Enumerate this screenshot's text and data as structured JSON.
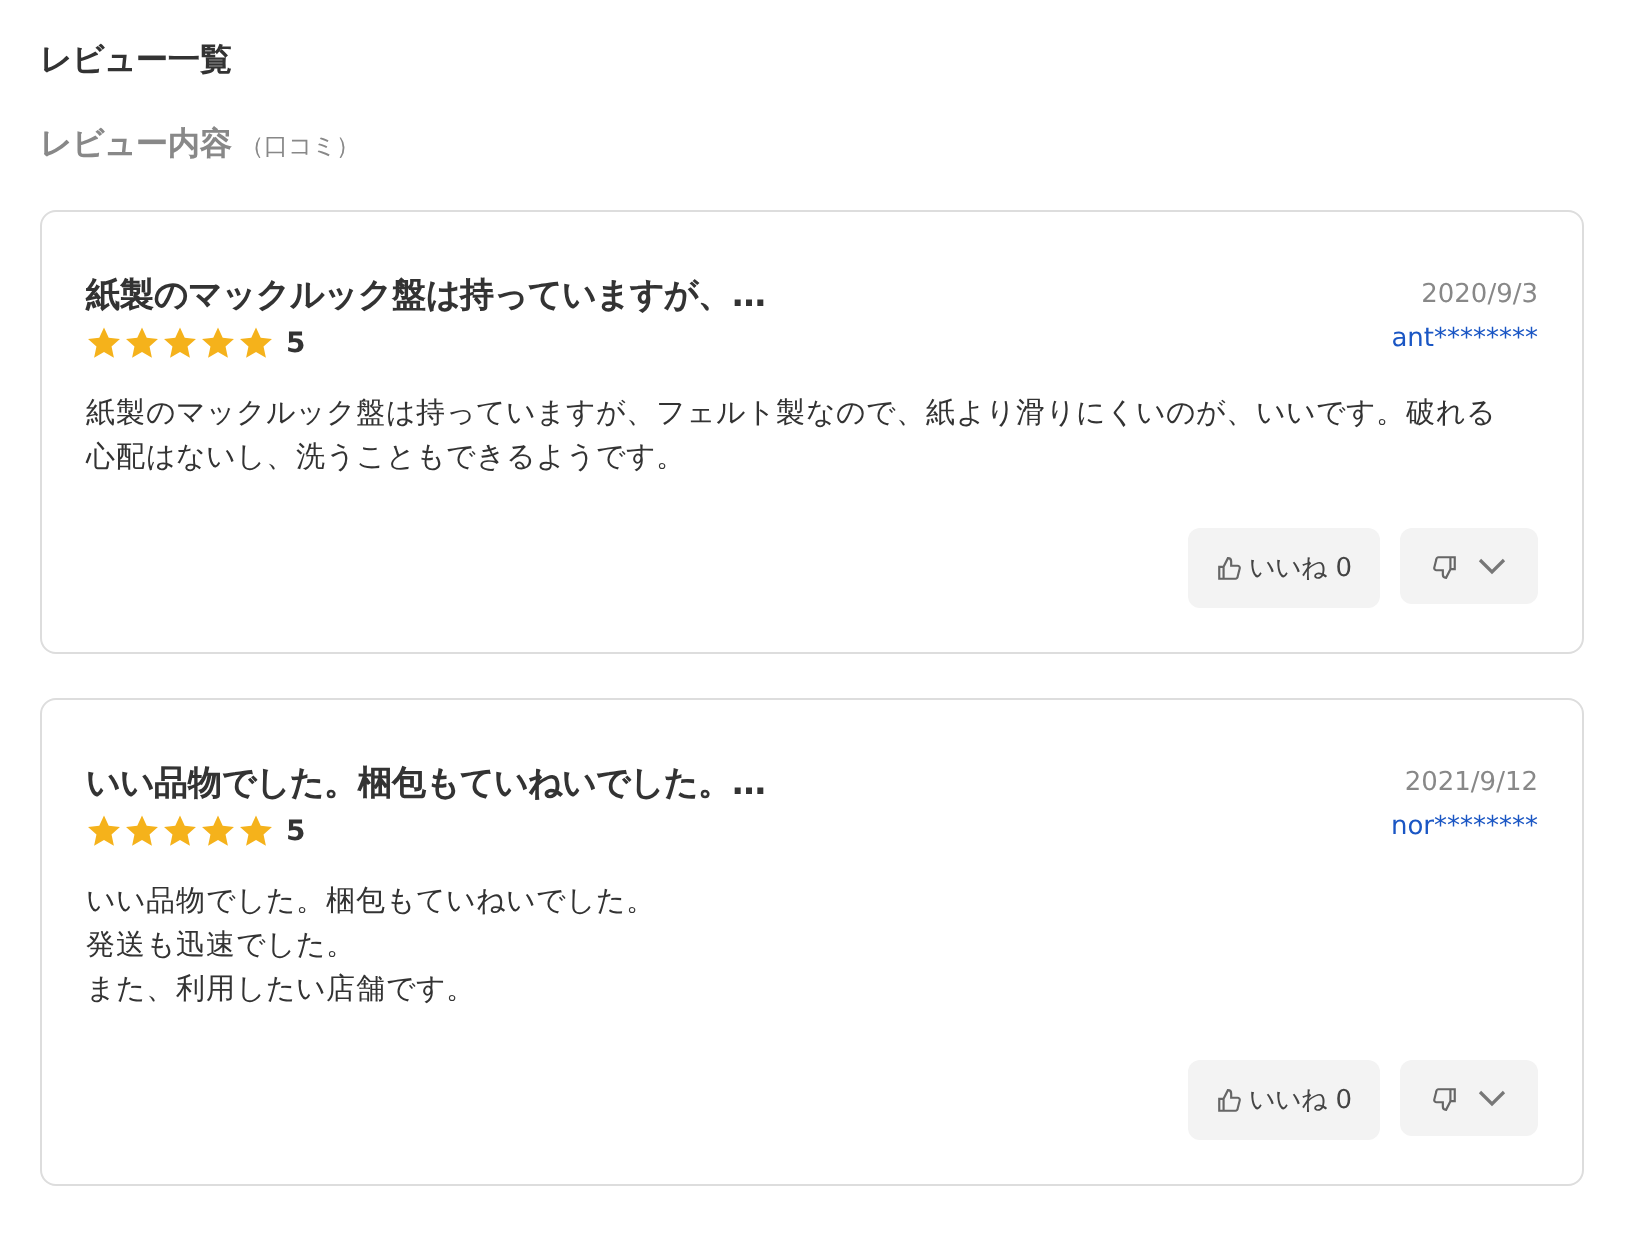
{
  "heading": "レビュー一覧",
  "subheading": {
    "title": "レビュー内容",
    "note": "（口コミ）"
  },
  "reviews": [
    {
      "title": "紙製のマックルック盤は持っていますが、…",
      "date": "2020/9/3",
      "stars": 5,
      "rating": "5",
      "user": "ant********",
      "body": [
        "紙製のマックルック盤は持っていますが、フェルト製なので、紙より滑りにくいのが、いいです。破れる心配はないし、洗うこともできるようです。"
      ],
      "like_label": "いいね 0"
    },
    {
      "title": "いい品物でした。梱包もていねいでした。…",
      "date": "2021/9/12",
      "stars": 5,
      "rating": "5",
      "user": "nor********",
      "body": [
        "いい品物でした。梱包もていねいでした。",
        "発送も迅速でした。",
        "また、利用したい店舗です。"
      ],
      "like_label": "いいね 0"
    }
  ]
}
